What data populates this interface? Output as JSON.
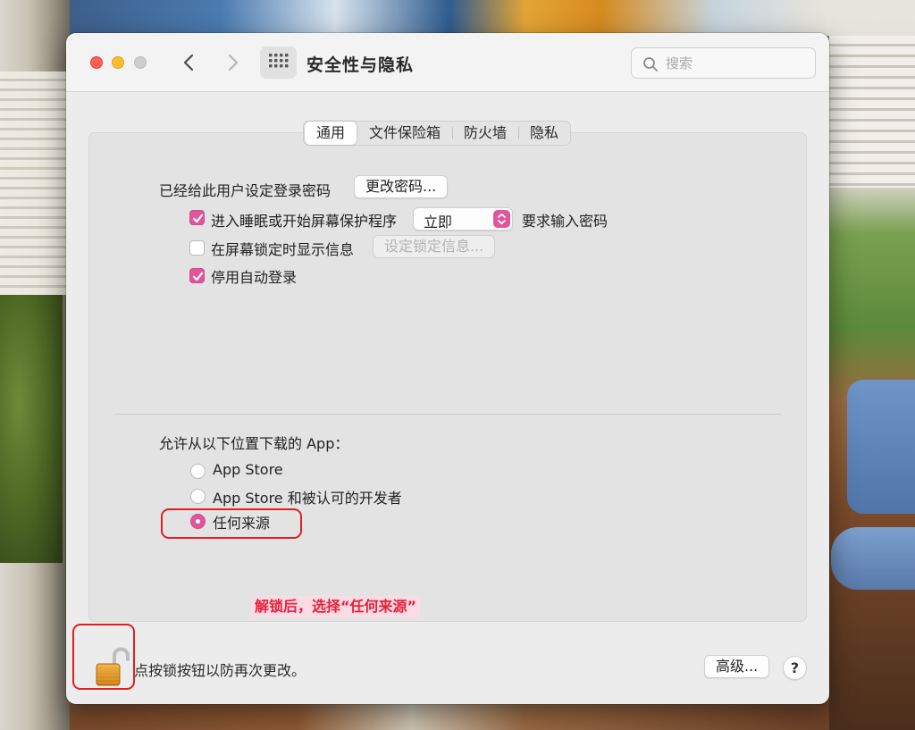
{
  "window": {
    "title": "安全性与隐私",
    "search_placeholder": "搜索"
  },
  "tabs": [
    {
      "label": "通用",
      "active": true
    },
    {
      "label": "文件保险箱",
      "active": false
    },
    {
      "label": "防火墙",
      "active": false
    },
    {
      "label": "隐私",
      "active": false
    }
  ],
  "general": {
    "login_password_label": "已经给此用户设定登录密码",
    "change_password_button": "更改密码...",
    "require_password": {
      "checked": true,
      "label_before": "进入睡眠或开始屏幕保护程序",
      "select_value": "立即",
      "label_after": "要求输入密码"
    },
    "show_message": {
      "checked": false,
      "label": "在屏幕锁定时显示信息",
      "button": "设定锁定信息..."
    },
    "disable_auto_login": {
      "checked": true,
      "label": "停用自动登录"
    }
  },
  "downloads": {
    "heading": "允许从以下位置下载的 App：",
    "options": [
      {
        "label": "App Store",
        "selected": false
      },
      {
        "label": "App Store 和被认可的开发者",
        "selected": false
      },
      {
        "label": "任何来源",
        "selected": true
      }
    ]
  },
  "annotation": "解锁后，选择“任何来源”",
  "footer": {
    "lock_text": "点按锁按钮以防再次更改。",
    "advanced_button": "高级...",
    "help_button": "?"
  },
  "colors": {
    "accent": "#e0559b",
    "highlight_box": "#e02020",
    "annotation_text": "#e8203a"
  },
  "icons": {
    "lock": "unlocked-padlock-icon",
    "back": "chevron-left-icon",
    "forward": "chevron-right-icon",
    "grid": "grid-icon",
    "search": "magnifier-icon"
  }
}
